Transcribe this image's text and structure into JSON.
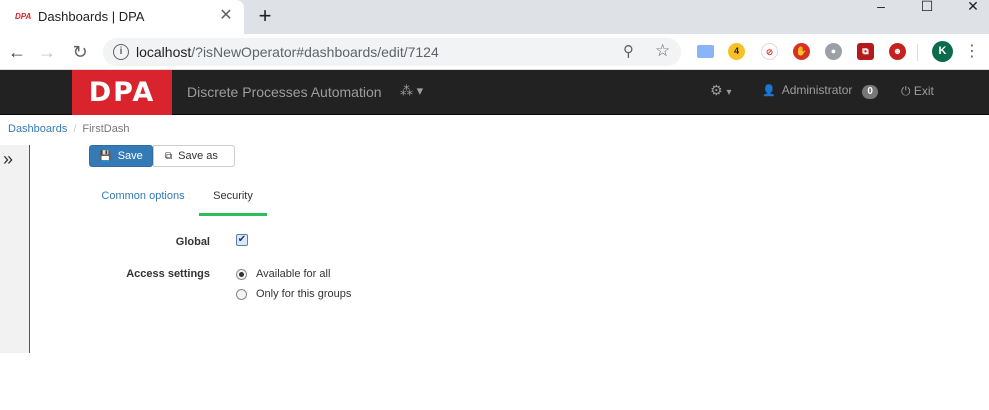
{
  "browser": {
    "tab_title": "Dashboards | DPA",
    "tab_favicon_text": "DPA",
    "url_host": "localhost",
    "url_rest": "/?isNewOperator#dashboards/edit/7124",
    "extension_badge": "4",
    "profile_initial": "K"
  },
  "navbar": {
    "logo": "DPA",
    "brand_name": "Discrete Processes Automation",
    "user_name": "Administrator",
    "user_badge": "0",
    "exit_label": "Exit",
    "colors": {
      "background": "#222222",
      "logo": "#d9232d",
      "text": "#9d9d9d"
    }
  },
  "breadcrumb": {
    "items": [
      {
        "label": "Dashboards"
      },
      {
        "label": "FirstDash"
      }
    ],
    "separator": "/"
  },
  "actions": {
    "save_label": "Save",
    "save_as_label": "Save as"
  },
  "tabs": [
    {
      "label": "Common options",
      "active": false
    },
    {
      "label": "Security",
      "active": true
    }
  ],
  "form": {
    "global_label": "Global",
    "global_checked": true,
    "access_label": "Access settings",
    "access_options": [
      {
        "label": "Available for all",
        "selected": true
      },
      {
        "label": "Only for this groups",
        "selected": false
      }
    ]
  },
  "icons": {
    "sidebar_toggle": "double-chevron-right-icon",
    "gear": "gear-icon",
    "user": "user-icon",
    "power": "power-icon",
    "save": "floppy-disk-icon",
    "copy": "copy-icon"
  },
  "accent_colors": {
    "primary": "#337ab7",
    "active_tab": "#2ebd59"
  }
}
